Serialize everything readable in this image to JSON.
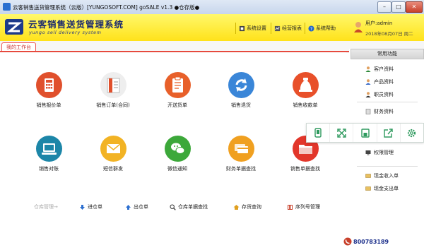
{
  "window": {
    "title": "云客销售送货管理系统（云版）[YUNGOSOFT.COM]    goSALE v1.3    ●仓存版●",
    "minimize": "–",
    "maximize": "□",
    "close": "✕"
  },
  "header": {
    "brand_title": "云客销售送货管理系统",
    "brand_sub": "yungo sell delivery system",
    "buttons": [
      {
        "label": "系统设置",
        "icon": "settings-icon"
      },
      {
        "label": "经营报表",
        "icon": "report-icon"
      },
      {
        "label": "系统帮助",
        "icon": "help-icon"
      }
    ],
    "user": {
      "label": "用户:admin",
      "date": "2018年08月07日 周二"
    }
  },
  "tabs": {
    "active": "我的工作台"
  },
  "tiles": [
    {
      "label": "销售报价单",
      "icon": "calculator-icon",
      "color": "#e0502c"
    },
    {
      "label": "销售订单(合同)",
      "icon": "book-icon",
      "color": "#eeeeee"
    },
    {
      "label": "开送货单",
      "icon": "clipboard-icon",
      "color": "#e8602a"
    },
    {
      "label": "销售退货",
      "icon": "refresh-icon",
      "color": "#3a86d8"
    },
    {
      "label": "销售收款单",
      "icon": "money-bag-icon",
      "color": "#e8502a"
    },
    {
      "label": "销售对账",
      "icon": "monitor-icon",
      "color": "#1c86a8"
    },
    {
      "label": "短信群发",
      "icon": "envelope-icon",
      "color": "#f2b324"
    },
    {
      "label": "微信通知",
      "icon": "wechat-icon",
      "color": "#3ca83a"
    },
    {
      "label": "财务单据查找",
      "icon": "cards-icon",
      "color": "#f0a020"
    },
    {
      "label": "销售单据查找",
      "icon": "folder-icon",
      "color": "#e2362a"
    }
  ],
  "bottom": {
    "group_label": "仓库管理→",
    "items": [
      {
        "label": "进仓单",
        "icon": "arrow-down-icon"
      },
      {
        "label": "出仓单",
        "icon": "arrow-up-icon"
      },
      {
        "label": "仓库单据查找",
        "icon": "search-icon"
      },
      {
        "label": "存货查询",
        "icon": "house-icon"
      },
      {
        "label": "序列号管理",
        "icon": "barcode-icon"
      }
    ]
  },
  "right_panel": {
    "heading": "常用功能",
    "items": [
      {
        "label": "客户资料",
        "icon": "person-icon"
      },
      {
        "label": "产品资料",
        "icon": "person-icon"
      },
      {
        "label": "职员资料",
        "icon": "person-icon"
      },
      {
        "label": "财务资料",
        "icon": "document-icon"
      },
      {
        "label": "权限管理",
        "icon": "monitor-small-icon"
      },
      {
        "label": "现金收入单",
        "icon": "cash-in-icon"
      },
      {
        "label": "现金支出单",
        "icon": "cash-out-icon"
      }
    ],
    "phone": "800783189"
  },
  "floating_toolbar": {
    "buttons": [
      "phone-frame-icon",
      "fullscreen-icon",
      "save-icon",
      "share-icon",
      "gear-icon"
    ],
    "color": "#2e9a5e"
  }
}
